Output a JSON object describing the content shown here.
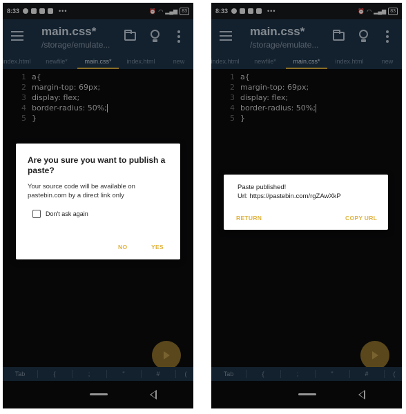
{
  "status_bar": {
    "time": "8:33",
    "battery": "83"
  },
  "app_bar": {
    "title": "main.css*",
    "subtitle": "/storage/emulate..."
  },
  "tabs": [
    "index.html",
    "newfile*",
    "main.css*",
    "index.html",
    "new"
  ],
  "active_tab": 2,
  "editor": {
    "lines": [
      {
        "num": "1",
        "code": "a{"
      },
      {
        "num": "2",
        "code": "margin-top: 69px;"
      },
      {
        "num": "3",
        "code": "display: flex;"
      },
      {
        "num": "4",
        "code": "border-radius: 50%;"
      },
      {
        "num": "5",
        "code": "}"
      }
    ]
  },
  "keys": [
    "Tab",
    "{",
    ";",
    "\"",
    "#",
    "("
  ],
  "publish_dialog": {
    "title": "Are you sure you want to publish a paste?",
    "message": "Your source code will be available on pastebin.com by a direct link only",
    "checkbox_label": "Don't ask again",
    "checkbox_checked": false,
    "no_label": "NO",
    "yes_label": "YES"
  },
  "published_dialog": {
    "title": "Paste published!",
    "url": "Url: https://pastebin.com/rgZAwXkP",
    "return_label": "RETURN",
    "copy_label": "COPY URL"
  },
  "colors": {
    "app_bar": "#1e3347",
    "accent": "#e0b440",
    "editor_bg": "#0b0b0d",
    "fab": "#8a6e2a"
  },
  "icons": [
    "menu-icon",
    "folder-icon",
    "lightbulb-icon",
    "more-vert-icon",
    "play-icon",
    "home-pill-icon",
    "back-icon"
  ]
}
